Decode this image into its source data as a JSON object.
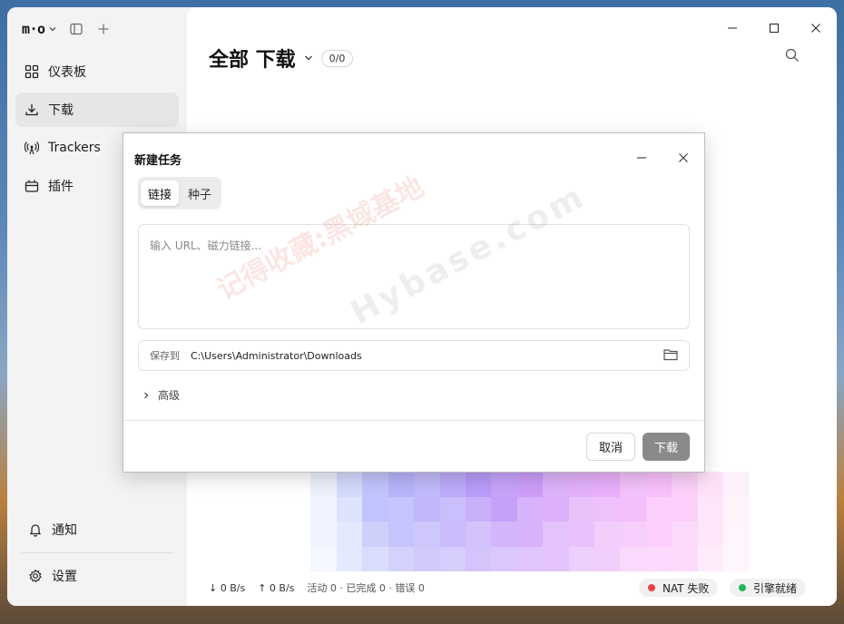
{
  "sidebar": {
    "logo": "m·o",
    "nav": [
      {
        "label": "仪表板",
        "icon": "dashboard-icon"
      },
      {
        "label": "下载",
        "icon": "download-icon"
      },
      {
        "label": "Trackers",
        "icon": "tracker-antenna-icon"
      },
      {
        "label": "插件",
        "icon": "plugin-icon"
      }
    ],
    "bottom": [
      {
        "label": "通知",
        "icon": "bell-icon"
      },
      {
        "label": "设置",
        "icon": "gear-icon"
      }
    ]
  },
  "main": {
    "title": "全部 下载",
    "count": "0/0"
  },
  "status": {
    "down_speed": "↓ 0 B/s",
    "up_speed": "↑ 0 B/s",
    "summary": "活动 0 · 已完成 0 · 错误 0",
    "nat": "NAT 失败",
    "engine": "引擎就绪",
    "nat_color": "#e8404a",
    "engine_color": "#22b45a"
  },
  "dialog": {
    "title": "新建任务",
    "tabs": [
      "链接",
      "种子"
    ],
    "active_tab": 0,
    "url_placeholder": "输入 URL、磁力链接...",
    "save_label": "保存到",
    "save_path": "C:\\Users\\Administrator\\Downloads",
    "advanced_label": "高级",
    "cancel_label": "取消",
    "download_label": "下载"
  },
  "watermark": {
    "text_cn": "记得收藏:黑域基地",
    "text_en": "Hybase.com"
  }
}
